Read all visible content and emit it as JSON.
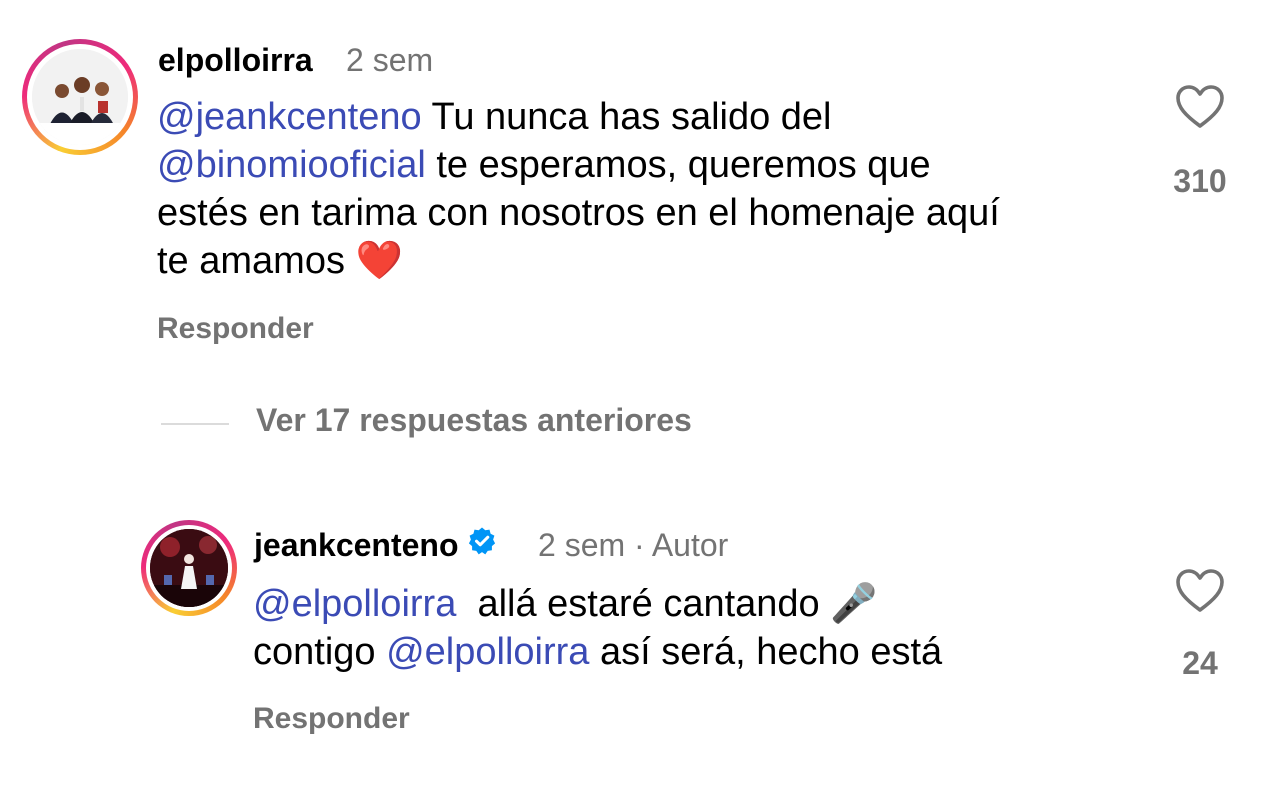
{
  "comments": [
    {
      "username": "elpolloirra",
      "time": "2 sem",
      "text_parts": {
        "mention1": "@jeankcenteno",
        "line1_rest": " Tu nunca has salido del",
        "mention2": "@binomiooficial",
        "line2_rest": " te esperamos, queremos que",
        "line3": "estés en tarima con nosotros en el homenaje aquí",
        "line4": "te amamos ",
        "emoji": "❤️"
      },
      "reply_label": "Responder",
      "like_count": "310",
      "like_icon": "heart-outline-icon"
    },
    {
      "username": "jeankcenteno",
      "verified_icon": "verified-badge-icon",
      "time": "2 sem",
      "separator": " · ",
      "author_label": "Autor",
      "text_parts": {
        "mention1": "@elpolloirra",
        "line1_rest": "  allá estaré cantando ",
        "emoji": "🎤",
        "line2_start": "contigo ",
        "mention2": "@elpolloirra",
        "line2_rest": " así será, hecho está"
      },
      "reply_label": "Responder",
      "like_count": "24",
      "like_icon": "heart-outline-icon"
    }
  ],
  "view_replies_label": "Ver 17 respuestas anteriores",
  "colors": {
    "mention": "#3b4bb5",
    "secondary_text": "#737373",
    "verified": "#0095f6"
  }
}
